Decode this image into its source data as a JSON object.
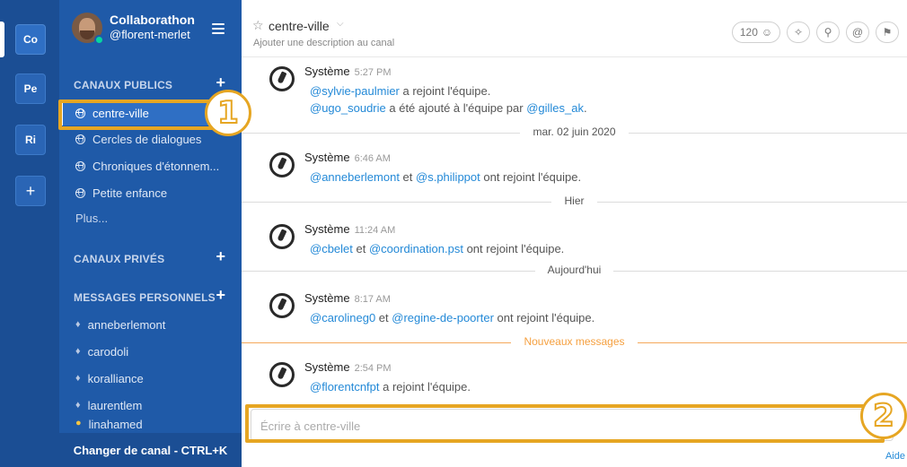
{
  "teams": [
    {
      "label": "Co",
      "active": true
    },
    {
      "label": "Pe",
      "active": false
    },
    {
      "label": "Ri",
      "active": false
    }
  ],
  "team_add_label": "+",
  "sidebar": {
    "team_name": "Collaborathon",
    "user_name": "@florent-merlet",
    "public_title": "CANAUX PUBLICS",
    "public_channels": [
      "centre-ville",
      "Cercles de dialogues",
      "Chroniques d'étonnem...",
      "Petite enfance"
    ],
    "more": "Plus...",
    "private_title": "CANAUX PRIVÉS",
    "dm_title": "MESSAGES PERSONNELS",
    "direct_messages": [
      "anneberlemont",
      "carodoli",
      "koralliance",
      "laurentlem",
      "linahamed"
    ],
    "switch_label": "Changer de canal - CTRL+K",
    "plus_glyph": "+"
  },
  "header": {
    "channel": "centre-ville",
    "description": "Ajouter une description au canal",
    "member_count": "120"
  },
  "feed": {
    "sender": "Système",
    "posts": [
      {
        "time": "5:27 PM",
        "lines": [
          [
            {
              "t": "@sylvie-paulmier",
              "m": true
            },
            {
              "t": " a rejoint l'équipe.",
              "m": false
            }
          ],
          [
            {
              "t": "@ugo_soudrie",
              "m": true
            },
            {
              "t": " a été ajouté à l'équipe par ",
              "m": false
            },
            {
              "t": "@gilles_ak",
              "m": true
            },
            {
              "t": ".",
              "m": false
            }
          ]
        ]
      },
      {
        "time": "6:46 AM",
        "lines": [
          [
            {
              "t": "@anneberlemont",
              "m": true
            },
            {
              "t": " et ",
              "m": false
            },
            {
              "t": "@s.philippot",
              "m": true
            },
            {
              "t": " ont rejoint l'équipe.",
              "m": false
            }
          ]
        ]
      },
      {
        "time": "11:24 AM",
        "lines": [
          [
            {
              "t": "@cbelet",
              "m": true
            },
            {
              "t": " et ",
              "m": false
            },
            {
              "t": "@coordination.pst",
              "m": true
            },
            {
              "t": " ont rejoint l'équipe.",
              "m": false
            }
          ]
        ]
      },
      {
        "time": "8:17 AM",
        "lines": [
          [
            {
              "t": "@carolineg0",
              "m": true
            },
            {
              "t": " et ",
              "m": false
            },
            {
              "t": "@regine-de-poorter",
              "m": true
            },
            {
              "t": " ont rejoint l'équipe.",
              "m": false
            }
          ]
        ]
      },
      {
        "time": "2:54 PM",
        "lines": [
          [
            {
              "t": "@florentcnfpt",
              "m": true
            },
            {
              "t": " a rejoint l'équipe.",
              "m": false
            }
          ]
        ]
      }
    ],
    "dividers": [
      "mar. 02 juin 2020",
      "Hier",
      "Aujourd'hui",
      "Nouveaux messages"
    ]
  },
  "composer": {
    "placeholder": "Écrire à centre-ville",
    "help": "Aide"
  },
  "callouts": [
    "1",
    "2"
  ],
  "colors": {
    "sidebar": "#1f5aa8",
    "team_bar": "#1b4e94",
    "highlight": "#e6a623",
    "mention": "#2389d7",
    "new_messages": "#f5a040"
  }
}
